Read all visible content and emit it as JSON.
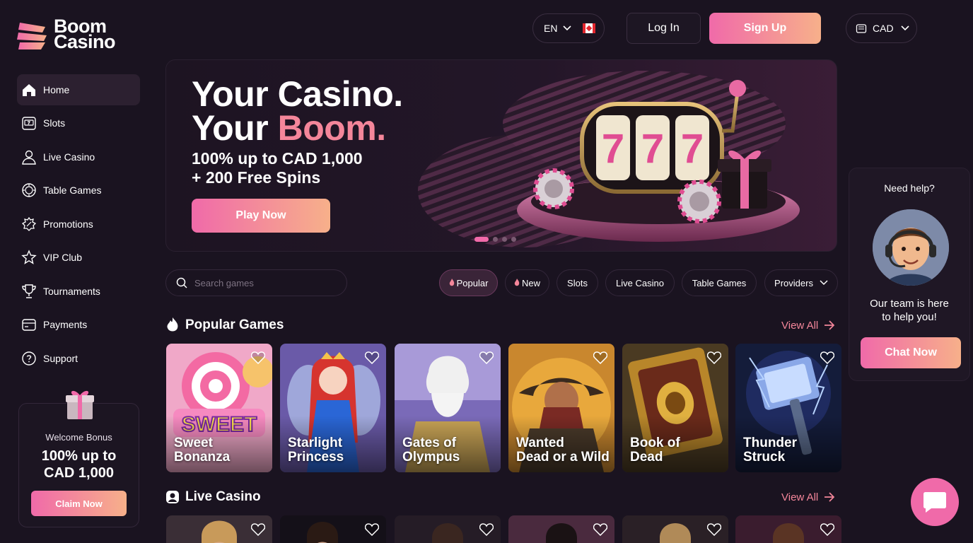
{
  "brand": {
    "line1": "Boom",
    "line2": "Casino"
  },
  "header": {
    "language": "EN",
    "login_label": "Log In",
    "signup_label": "Sign Up",
    "currency": "CAD"
  },
  "sidebar": {
    "items": [
      {
        "label": "Home",
        "icon": "home-icon"
      },
      {
        "label": "Slots",
        "icon": "slots-icon"
      },
      {
        "label": "Live Casino",
        "icon": "live-casino-icon"
      },
      {
        "label": "Table Games",
        "icon": "table-games-icon"
      },
      {
        "label": "Promotions",
        "icon": "promotions-icon"
      },
      {
        "label": "VIP Club",
        "icon": "vip-star-icon"
      },
      {
        "label": "Tournaments",
        "icon": "trophy-icon"
      },
      {
        "label": "Payments",
        "icon": "wallet-icon"
      },
      {
        "label": "Support",
        "icon": "support-icon"
      }
    ],
    "bonus": {
      "small": "Welcome Bonus",
      "line1": "100% up to",
      "line2": "CAD 1,000",
      "cta": "Claim Now"
    }
  },
  "hero": {
    "line1": "Your Casino.",
    "line2_a": "Your",
    "line2_b": "Boom.",
    "sub1": "100% up to CAD 1,000",
    "sub2": "+ 200 Free Spins",
    "cta": "Play Now",
    "slide_count": 4,
    "active_slide": 1
  },
  "search": {
    "placeholder": "Search games"
  },
  "filters": [
    "Popular",
    "New",
    "Slots",
    "Live Casino",
    "Table Games",
    "Providers"
  ],
  "sections": {
    "popular": {
      "title": "Popular Games",
      "view_all": "View All"
    },
    "live": {
      "title": "Live Casino",
      "view_all": "View All"
    }
  },
  "games": [
    {
      "line1": "Sweet",
      "line2": "Bonanza"
    },
    {
      "line1": "Starlight",
      "line2": "Princess"
    },
    {
      "line1": "Gates of",
      "line2": "Olympus"
    },
    {
      "line1": "Wanted",
      "line2": "Dead or a Wild"
    },
    {
      "line1": "Book of",
      "line2": "Dead"
    },
    {
      "line1": "Thunder",
      "line2": "Struck"
    }
  ],
  "help": {
    "question": "Need help?",
    "text1": "Our team is here",
    "text2": "to help you!",
    "cta": "Chat Now"
  },
  "colors": {
    "accent_pink": "#f06aa9",
    "accent_peach": "#f7b08a",
    "background": "#1a1320"
  }
}
